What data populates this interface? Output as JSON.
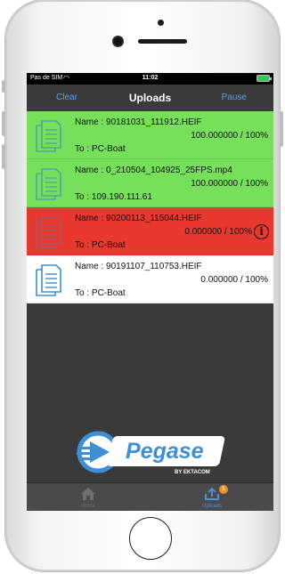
{
  "status_bar": {
    "carrier": "Pas de SIM",
    "wifi_icon": "wifi-icon",
    "time": "11:02",
    "battery_icon": "battery-icon"
  },
  "nav": {
    "left_button": "Clear",
    "title": "Uploads",
    "right_button": "Pause"
  },
  "uploads": [
    {
      "name": "Name :  90181031_111912.HEIF",
      "progress": "100.000000  / 100%",
      "destination": "To :  PC-Boat",
      "status": "completed",
      "color": "#76e05a"
    },
    {
      "name": "Name :  0_210504_104925_25FPS.mp4",
      "progress": "100.000000  / 100%",
      "destination": "To :  109.190.111.61",
      "status": "completed",
      "color": "#76e05a"
    },
    {
      "name": "Name :  90200113_115044.HEIF",
      "progress": "0.000000  / 100%",
      "destination": "To :  PC-Boat",
      "status": "error",
      "color": "#e8382f",
      "info_icon": "info-circle-icon"
    },
    {
      "name": "Name :  90191107_110753.HEIF",
      "progress": "0.000000  / 100%",
      "destination": "To :  PC-Boat",
      "status": "pending",
      "color": "#ffffff"
    }
  ],
  "logo": {
    "brand": "Pegase",
    "tagline": "BY EKTACOM",
    "accent": "#3d8fd6"
  },
  "tabs": [
    {
      "label": "Home",
      "icon": "home-icon",
      "selected": false
    },
    {
      "label": "Uploads",
      "icon": "upload-tray-icon",
      "selected": true,
      "badge": "1"
    }
  ],
  "colors": {
    "accent": "#5aa0e8",
    "success": "#76e05a",
    "error": "#e8382f",
    "background": "#3a3a3a"
  }
}
